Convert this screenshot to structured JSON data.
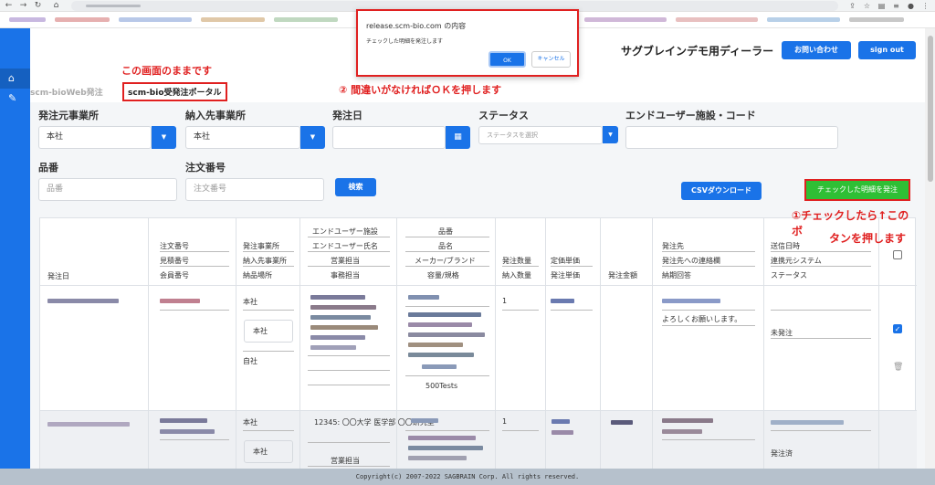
{
  "browser": {
    "tab_icons": [
      "back-icon",
      "forward-icon",
      "reload-icon",
      "home-icon"
    ],
    "extensions": [
      "share-icon",
      "star-icon",
      "puzzle-icon",
      "menu-icon"
    ]
  },
  "header": {
    "dealer_title": "サグブレインデモ用ディーラー",
    "contact_button": "お問い合わせ",
    "signout_button": "sign out",
    "breadcrumb_root": "scm-bioWeb発注",
    "breadcrumb_current": "scm-bio受発注ポータル"
  },
  "annotations": {
    "note_screen": "この画面のままです",
    "note_ok": "② 間違いがなければＯＫを押します",
    "note_check_1": "①チェックしたら↑このボ",
    "note_check_2": "タンを押します"
  },
  "dialog": {
    "title": "release.scm-bio.com の内容",
    "message": "チェックした明細を発注します",
    "ok_label": "OK",
    "cancel_label": "キャンセル"
  },
  "filters": {
    "origin_label": "発注元事業所",
    "origin_value": "本社",
    "dest_label": "納入先事業所",
    "dest_value": "本社",
    "date_label": "発注日",
    "status_label": "ステータス",
    "status_placeholder": "ステータスを選択",
    "enduser_label": "エンドユーザー施設・コード",
    "item_label": "品番",
    "item_placeholder": "品番",
    "order_label": "注文番号",
    "order_placeholder": "注文番号",
    "search_button": "検索",
    "csv_button": "CSVダウンロード",
    "order_checked_button": "チェックした明細を発注"
  },
  "table": {
    "headers": {
      "order_date": "発注日",
      "order_no": [
        "注文番号",
        "見積番号",
        "会員番号"
      ],
      "offices": [
        "発注事業所",
        "納入先事業所",
        "納品場所"
      ],
      "enduser": [
        "エンドユーザー施設",
        "エンドユーザー氏名",
        "営業担当",
        "事務担当"
      ],
      "product": [
        "品番",
        "品名",
        "メーカー/ブランド",
        "容量/規格"
      ],
      "qty": [
        "発注数量",
        "納入数量"
      ],
      "price": [
        "定価単価",
        "発注単価"
      ],
      "amount": "発注金額",
      "supplier": [
        "発注先",
        "発注先への連絡欄",
        "納期回答"
      ],
      "send": [
        "送信日時",
        "連携元システム",
        "ステータス"
      ]
    },
    "rows": [
      {
        "qty": "1",
        "office": "本社",
        "dest": "本社",
        "place": "自社",
        "product_spec": "500Tests",
        "supplier_note": "よろしくお願いします。",
        "status": "未発注",
        "checked": true
      },
      {
        "qty": "1",
        "office": "本社",
        "dest": "本社",
        "enduser": "12345: 〇〇大学 医学部 〇〇研究室",
        "sales": "営業担当",
        "status": "発注済",
        "checked": false
      }
    ]
  },
  "footer": {
    "copyright": "Copyright(c) 2007-2022 SAGBRAIN Corp. All rights reserved."
  }
}
